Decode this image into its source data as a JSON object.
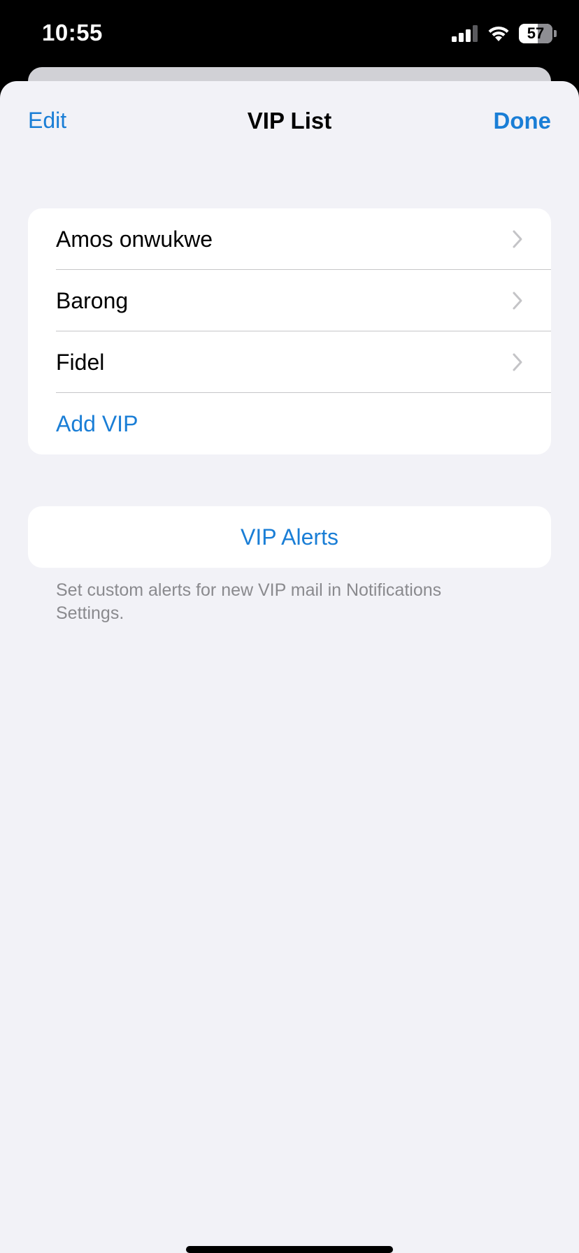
{
  "status_bar": {
    "time": "10:55",
    "battery_level": "57",
    "battery_fraction": 0.57,
    "icons": [
      "signal-icon",
      "wifi-icon",
      "battery-icon"
    ]
  },
  "nav": {
    "left_label": "Edit",
    "title": "VIP List",
    "right_label": "Done"
  },
  "vip_list": {
    "items": [
      {
        "label": "Amos onwukwe"
      },
      {
        "label": "Barong"
      },
      {
        "label": "Fidel"
      }
    ],
    "add_label": "Add VIP"
  },
  "alerts": {
    "button_label": "VIP Alerts",
    "note": "Set custom alerts for new VIP mail in Notifications Settings."
  },
  "colors": {
    "accent": "#1a7ed6",
    "background": "#f2f2f7",
    "card": "#ffffff",
    "secondary_text": "#8a8a8e",
    "separator": "#c6c6c8"
  }
}
